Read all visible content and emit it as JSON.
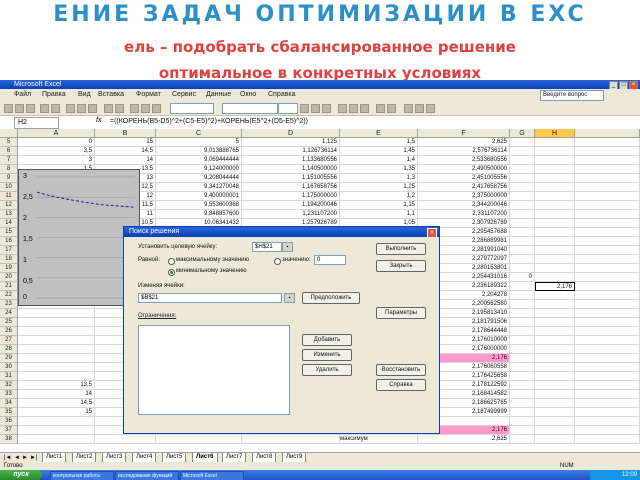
{
  "slide": {
    "title": "ЕНИЕ ЗАДАЧ ОПТИМИЗАЦИИ В EXC",
    "subtitle": "ель – подобрать сбалансированное решение",
    "subtitle2": "оптимальное в конкретных условиях"
  },
  "excel": {
    "window_title": "Microsoft Excel",
    "menu": [
      "Файл",
      "Правка",
      "Вид",
      "Вставка",
      "Формат",
      "Сервис",
      "Данные",
      "Окно",
      "Справка"
    ],
    "help_placeholder": "Введите вопрос",
    "name_box": "H2",
    "formula": "=((КОРЕНЬ(B5-D5)^2+(C5-E5)^2)+КОРЕНЬ(E5^2+(D5-E5)^2))",
    "columns": [
      "A",
      "B",
      "C",
      "D",
      "E",
      "F",
      "G",
      "H"
    ],
    "rows": [
      {
        "n": "5",
        "a": "0",
        "b": "15",
        "c": "5",
        "d": "1,125",
        "e": "1,5",
        "f": "2,625"
      },
      {
        "n": "6",
        "a": "3,5",
        "b": "14,5",
        "c": "9,013888765",
        "d": "1,126736114",
        "e": "1,45",
        "f": "2,576736114"
      },
      {
        "n": "7",
        "a": "3",
        "b": "14",
        "c": "9,069444444",
        "d": "1,133680556",
        "e": "1,4",
        "f": "2,533680556"
      },
      {
        "n": "8",
        "a": "1,5",
        "b": "13,5",
        "c": "9,124000000",
        "d": "1,140500000",
        "e": "1,35",
        "f": "2,490500000"
      },
      {
        "n": "9",
        "a": "2",
        "b": "13",
        "c": "9,208044444",
        "d": "1,151005556",
        "e": "1,3",
        "f": "2,451005556"
      },
      {
        "n": "10",
        "a": "2,5",
        "b": "12,5",
        "c": "9,341270048",
        "d": "1,167658756",
        "e": "1,25",
        "f": "2,417658756"
      },
      {
        "n": "11",
        "a": "3",
        "b": "12",
        "c": "9,400000001",
        "d": "1,175000000",
        "e": "1,2",
        "f": "2,375000000"
      },
      {
        "n": "12",
        "a": "3,5",
        "b": "11,5",
        "c": "9,553600368",
        "d": "1,194200046",
        "e": "1,15",
        "f": "2,344200046"
      },
      {
        "n": "13",
        "a": "4",
        "b": "11",
        "c": "9,848857600",
        "d": "1,231107200",
        "e": "1,1",
        "f": "2,331107200"
      },
      {
        "n": "14",
        "a": "4,5",
        "b": "10,5",
        "c": "10,06341432",
        "d": "1,257926789",
        "e": "1,05",
        "f": "2,307926789"
      },
      {
        "n": "15",
        "a": "",
        "b": "",
        "c": "",
        "d": "",
        "e": "",
        "f": "2,295457688"
      },
      {
        "n": "16",
        "a": "",
        "b": "",
        "c": "",
        "d": "",
        "e": "",
        "f": "2,286889981"
      },
      {
        "n": "17",
        "a": "",
        "b": "",
        "c": "",
        "d": "",
        "e": "",
        "f": "2,281991040"
      },
      {
        "n": "18",
        "a": "",
        "b": "",
        "c": "",
        "d": "",
        "e": "",
        "f": "2,279772097"
      },
      {
        "n": "19",
        "a": "",
        "b": "",
        "c": "",
        "d": "",
        "e": "",
        "f": "2,280153801"
      },
      {
        "n": "20",
        "a": "",
        "b": "",
        "c": "",
        "d": "",
        "e": "",
        "f": "2,254431016"
      },
      {
        "n": "21",
        "a": "",
        "b": "",
        "c": "",
        "d": "",
        "e": "",
        "f": "2,236189322"
      },
      {
        "n": "22",
        "a": "",
        "b": "",
        "c": "",
        "d": "",
        "e": "",
        "f": "2,204278"
      },
      {
        "n": "23",
        "a": "",
        "b": "",
        "c": "",
        "d": "",
        "e": "",
        "f": "2,200562580"
      },
      {
        "n": "24",
        "a": "",
        "b": "",
        "c": "",
        "d": "",
        "e": "",
        "f": "2,195813410"
      },
      {
        "n": "25",
        "a": "",
        "b": "",
        "c": "",
        "d": "",
        "e": "",
        "f": "2,181791506"
      },
      {
        "n": "26",
        "a": "",
        "b": "",
        "c": "",
        "d": "",
        "e": "",
        "f": "2,178644448"
      },
      {
        "n": "27",
        "a": "",
        "b": "",
        "c": "",
        "d": "",
        "e": "",
        "f": "2,176010000"
      },
      {
        "n": "28",
        "a": "",
        "b": "",
        "c": "",
        "d": "",
        "e": "",
        "f": "2,176000000"
      },
      {
        "n": "29",
        "a": "",
        "b": "",
        "c": "",
        "d": "",
        "e": "",
        "f": "2,176"
      },
      {
        "n": "30",
        "a": "",
        "b": "",
        "c": "",
        "d": "",
        "e": "",
        "f": "2,176060558"
      },
      {
        "n": "31",
        "a": "",
        "b": "",
        "c": "",
        "d": "",
        "e": "0,2",
        "f": "2,176425658"
      },
      {
        "n": "32",
        "a": "13,5",
        "b": "1,5",
        "c": "16,22498674",
        "d": "2,028122592",
        "e": "0,15",
        "f": "2,178122592"
      },
      {
        "n": "33",
        "a": "14",
        "b": "1",
        "c": "16,54331666",
        "d": "2,068414582",
        "e": "0,1",
        "f": "2,168414582"
      },
      {
        "n": "34",
        "a": "14,5",
        "b": "0,5",
        "c": "17,09300612",
        "d": "2,136625765",
        "e": "0,05",
        "f": "2,186625765"
      },
      {
        "n": "35",
        "a": "15",
        "b": "0",
        "c": "17,4999999",
        "d": "2,187499999",
        "e": "0",
        "f": "2,187499999"
      },
      {
        "n": "36",
        "a": "",
        "b": "",
        "c": "",
        "d": "",
        "e": "",
        "f": ""
      },
      {
        "n": "37",
        "a": "",
        "b": "",
        "c": "",
        "d": "",
        "e": "минимум",
        "f": "2,176"
      },
      {
        "n": "38",
        "a": "",
        "b": "",
        "c": "",
        "d": "",
        "e": "максимум",
        "f": "2,625"
      }
    ],
    "g20": "0",
    "h21": "2,176",
    "chart_yticks": [
      "3",
      "2,5",
      "2",
      "1,5",
      "1",
      "0,5",
      "0"
    ],
    "chart_line_values": [
      2.625,
      2.55,
      2.49,
      2.44,
      2.39,
      2.35,
      2.31,
      2.29,
      2.27,
      2.25
    ],
    "dialog": {
      "title": "Поиск решения",
      "target_label": "Установить целевую ячейку:",
      "target_value": "$H$21",
      "equal_label": "Равной:",
      "max_label": "максимальному значению",
      "value_label": "значению:",
      "value_input": "0",
      "min_label": "минимальному значению",
      "changing_label": "Изменяя ячейки:",
      "changing_value": "$B$21",
      "guess_btn": "Предположить",
      "constraints_label": "Ограничения:",
      "execute_btn": "Выполнить",
      "close_btn": "Закрыть",
      "params_btn": "Параметры",
      "add_btn": "Добавить",
      "change_btn": "Изменить",
      "delete_btn": "Удалить",
      "restore_btn": "Восстановить",
      "help_btn": "Справка"
    },
    "sheet_tabs": [
      "Лист1",
      "Лист2",
      "Лист3",
      "Лист4",
      "Лист5",
      "Лист6",
      "Лист7",
      "Лист8",
      "Лист9"
    ],
    "active_tab": "Лист6",
    "status_left": "Готово",
    "status_right": "NUM",
    "taskbar": {
      "start": "пуск",
      "tasks": [
        "контрольная работа",
        "исследование функций",
        "Microsoft Excel"
      ],
      "clock": "12:09"
    }
  }
}
